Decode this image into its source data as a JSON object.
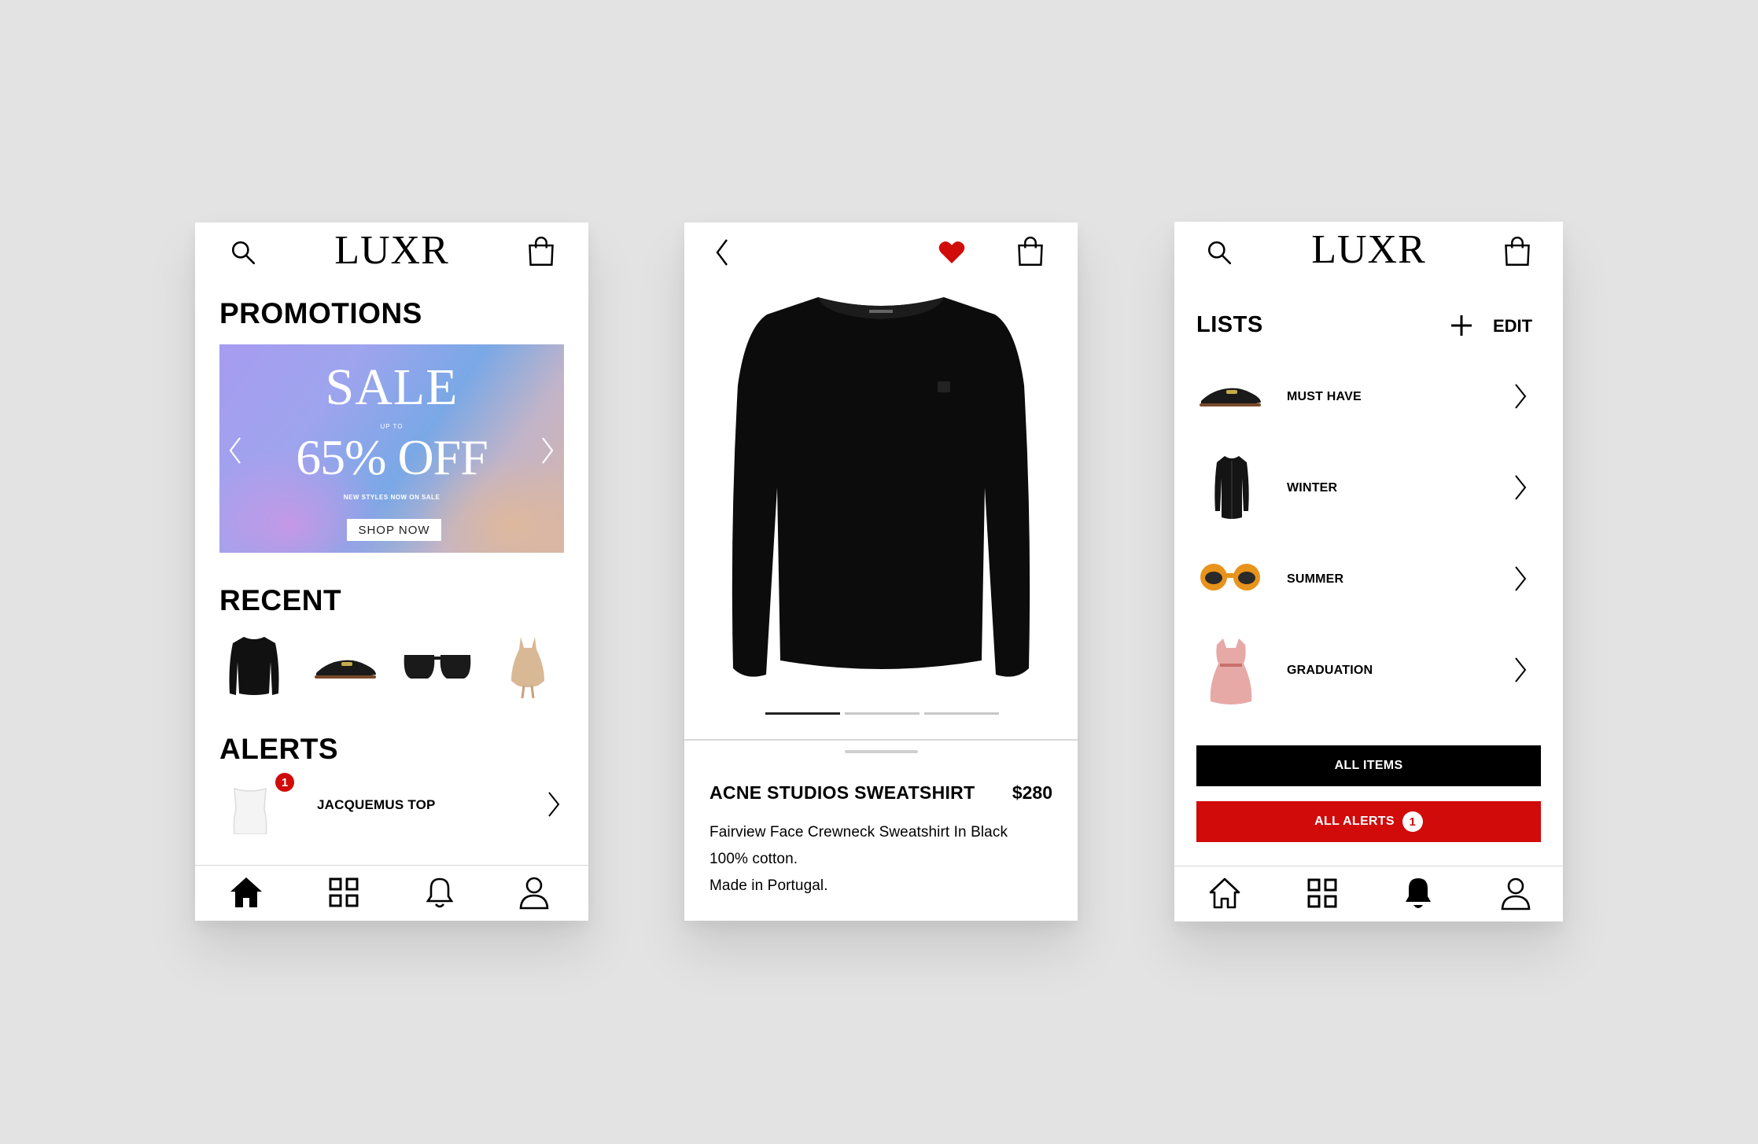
{
  "home": {
    "logo": "LUXR",
    "promotions_title": "PROMOTIONS",
    "banner": {
      "sale": "SALE",
      "up_to": "UP TO",
      "discount": "65% OFF",
      "subtitle": "NEW STYLES NOW ON SALE",
      "cta": "SHOP NOW"
    },
    "recent_title": "RECENT",
    "recent_items": [
      "black-sweatshirt",
      "black-loafer-mule",
      "black-sunglasses",
      "beige-mini-dress"
    ],
    "alerts_title": "ALERTS",
    "alert": {
      "label": "JACQUEMUS TOP",
      "badge": "1"
    },
    "tabs": [
      "home-icon",
      "grid-icon",
      "bell-icon",
      "user-icon"
    ],
    "active_tab": "home"
  },
  "product": {
    "title": "ACNE STUDIOS SWEATSHIRT",
    "price": "$280",
    "description": [
      "Fairview Face Crewneck Sweatshirt In Black",
      "100% cotton.",
      "Made in Portugal."
    ],
    "image_count": 3,
    "active_image": 1,
    "favorited": true,
    "favorite_color": "#d10a0a"
  },
  "lists": {
    "logo": "LUXR",
    "title": "LISTS",
    "edit_label": "EDIT",
    "items": [
      {
        "label": "MUST HAVE",
        "thumb": "loafer-mule"
      },
      {
        "label": "WINTER",
        "thumb": "black-coat"
      },
      {
        "label": "SUMMER",
        "thumb": "orange-sunglasses"
      },
      {
        "label": "GRADUATION",
        "thumb": "pink-dress"
      }
    ],
    "all_items_label": "ALL ITEMS",
    "all_alerts_label": "ALL ALERTS",
    "all_alerts_badge": "1",
    "active_tab": "alerts"
  },
  "colors": {
    "accent_red": "#d10a0a",
    "black": "#000000",
    "background": "#e3e3e3"
  }
}
